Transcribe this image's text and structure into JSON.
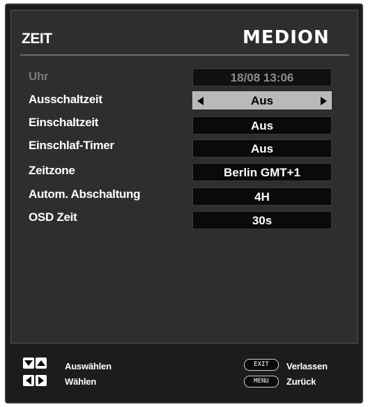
{
  "header": {
    "title": "ZEIT",
    "logo_text": "MEDION"
  },
  "rows": [
    {
      "label": "Uhr",
      "value": "18/08  13:06",
      "disabled": true
    },
    {
      "label": "Ausschaltzeit",
      "value": "Aus",
      "selected": true
    },
    {
      "label": "Einschaltzeit",
      "value": "Aus"
    },
    {
      "label": "Einschlaf-Timer",
      "value": "Aus"
    },
    {
      "label": "Zeitzone",
      "value": "Berlin GMT+1"
    },
    {
      "label": "Autom. Abschaltung",
      "value": "4H"
    },
    {
      "label": "OSD Zeit",
      "value": "30s"
    }
  ],
  "footer": {
    "nav_updown_label": "Auswählen",
    "nav_leftright_label": "Wählen",
    "exit_key": "EXIT",
    "exit_label": "Verlassen",
    "menu_key": "MENU",
    "menu_label": "Zurück"
  },
  "icons": {
    "arrow_down": "arrow-down-key-icon",
    "arrow_up": "arrow-up-key-icon",
    "arrow_left": "arrow-left-key-icon",
    "arrow_right": "arrow-right-key-icon"
  },
  "colors": {
    "background": "#2e2e2e",
    "selected_value_bg": "#b9b9b9",
    "value_bg": "#0a0a0a",
    "text": "#ffffff",
    "dim_text": "#7a7a7a"
  }
}
